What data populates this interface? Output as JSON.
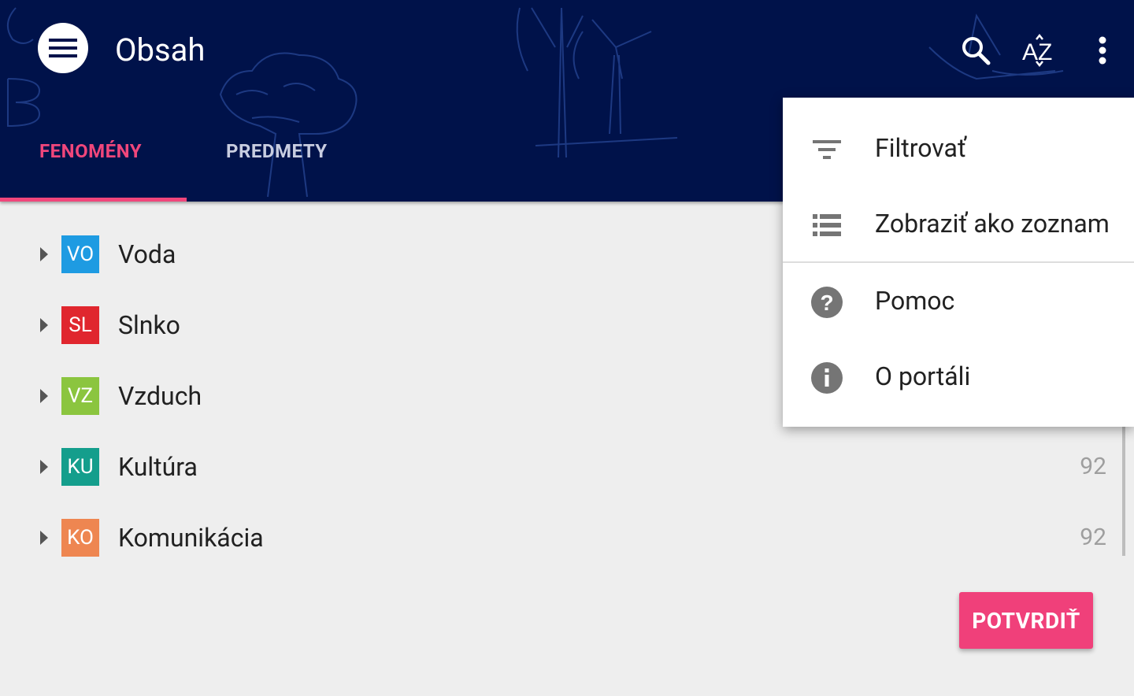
{
  "header": {
    "title": "Obsah",
    "menu_icon": "hamburger-icon",
    "actions": [
      {
        "icon": "search-icon"
      },
      {
        "icon": "sort-az-icon",
        "label": "AZ"
      },
      {
        "icon": "more-vert-icon"
      }
    ]
  },
  "tabs": [
    {
      "label": "FENOMÉNY",
      "active": true
    },
    {
      "label": "PREDMETY",
      "active": false
    }
  ],
  "list": {
    "items": [
      {
        "code": "VO",
        "name": "Voda",
        "count": "",
        "color": "#1e9be2"
      },
      {
        "code": "SL",
        "name": "Slnko",
        "count": "",
        "color": "#e0262e"
      },
      {
        "code": "VZ",
        "name": "Vzduch",
        "count": "",
        "color": "#8bc53f"
      },
      {
        "code": "KU",
        "name": "Kultúra",
        "count": "92",
        "color": "#149e8c"
      },
      {
        "code": "KO",
        "name": "Komunikácia",
        "count": "92",
        "color": "#ee8651"
      }
    ]
  },
  "confirm_button": {
    "label": "POTVRDIŤ"
  },
  "overflow_menu": {
    "items": [
      {
        "icon": "filter-icon",
        "label": "Filtrovať"
      },
      {
        "icon": "list-view-icon",
        "label": "Zobraziť ako zoznam"
      },
      {
        "icon": "help-icon",
        "label": "Pomoc"
      },
      {
        "icon": "info-icon",
        "label": "O portáli"
      }
    ]
  },
  "colors": {
    "appbar": "#00124a",
    "accent": "#f0467b",
    "background": "#eeeeee"
  }
}
